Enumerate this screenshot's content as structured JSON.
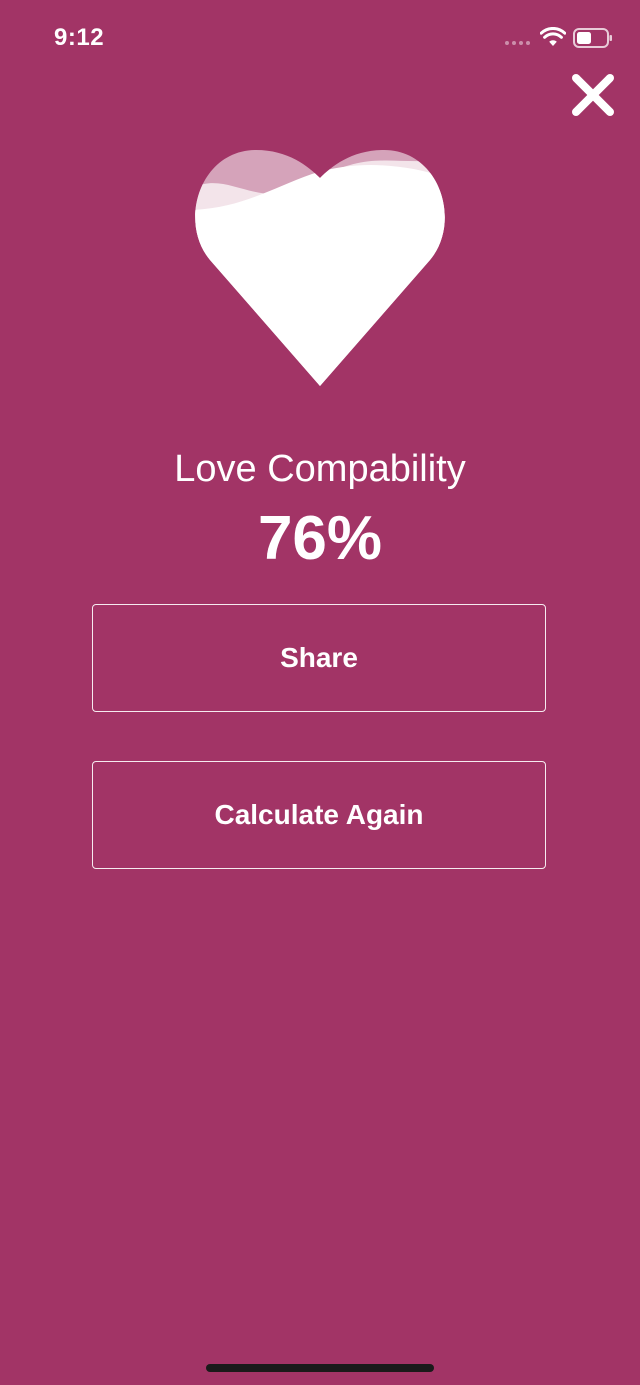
{
  "status_bar": {
    "time": "9:12"
  },
  "icons": {
    "close": "close-icon",
    "heart": "heart-icon",
    "wifi": "wifi-icon",
    "battery": "battery-icon"
  },
  "result": {
    "title": "Love Compability",
    "percent_label": "76%",
    "percent_value": 76
  },
  "buttons": {
    "share_label": "Share",
    "again_label": "Calculate Again"
  },
  "colors": {
    "background": "#a23466",
    "foreground": "#ffffff"
  }
}
